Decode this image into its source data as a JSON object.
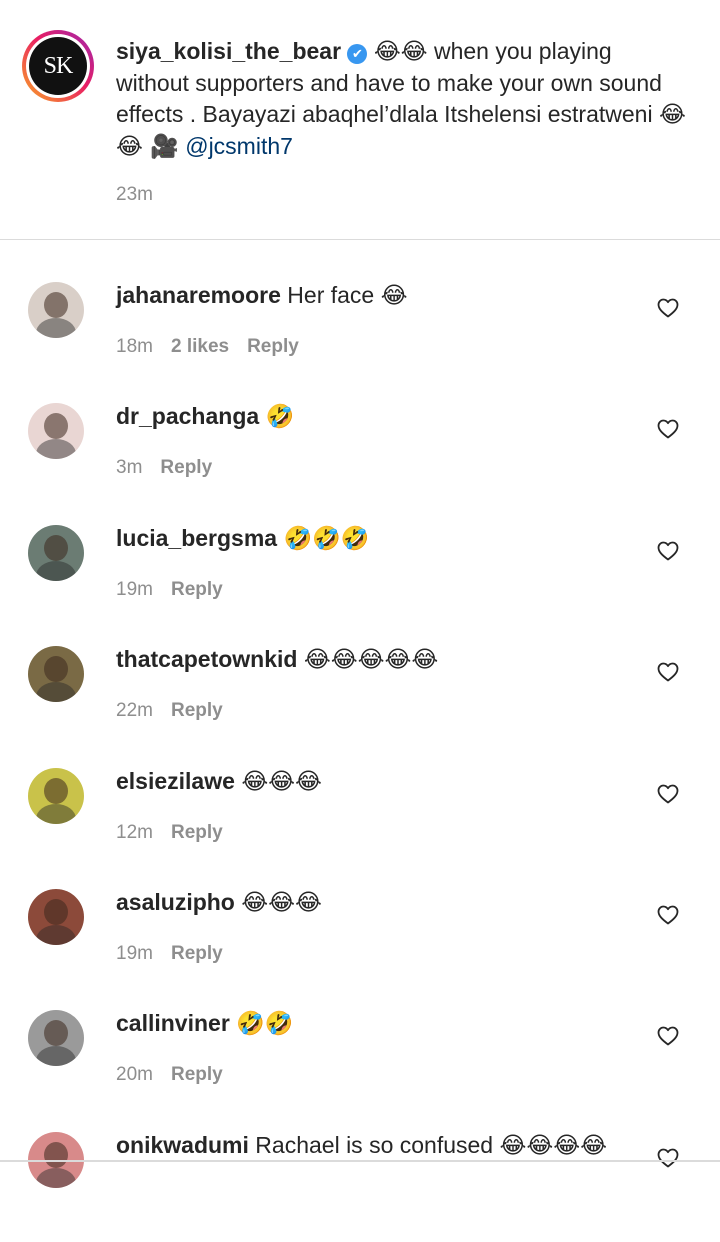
{
  "caption": {
    "avatar_initials": "SK",
    "username": "siya_kolisi_the_bear",
    "verified_mark": "✔",
    "text_emoji_lead": "😂😂",
    "text": "when you playing without supporters and have to make your own sound effects . Bayayazi abaqhel’dlala Itshelensi estratweni",
    "text_emoji_tail": "😂😂 🎥",
    "mention": "@jcsmith7",
    "time": "23m"
  },
  "comments": [
    {
      "username": "jahanaremoore",
      "text": "Her face",
      "emoji": "😂",
      "time": "18m",
      "likes": "2 likes",
      "reply": "Reply",
      "avatar_bg": "#d9cfc8"
    },
    {
      "username": "dr_pachanga",
      "text": "",
      "emoji": "🤣",
      "time": "3m",
      "likes": "",
      "reply": "Reply",
      "avatar_bg": "#e9d6d3"
    },
    {
      "username": "lucia_bergsma",
      "text": "",
      "emoji": "🤣🤣🤣",
      "time": "19m",
      "likes": "",
      "reply": "Reply",
      "avatar_bg": "#6b7c73"
    },
    {
      "username": "thatcapetownkid",
      "text": "",
      "emoji": "😂😂😂😂😂",
      "time": "22m",
      "likes": "",
      "reply": "Reply",
      "avatar_bg": "#7a6a45"
    },
    {
      "username": "elsiezilawe",
      "text": "",
      "emoji": "😂😂😂",
      "time": "12m",
      "likes": "",
      "reply": "Reply",
      "avatar_bg": "#c9c24a"
    },
    {
      "username": "asaluzipho",
      "text": "",
      "emoji": "😂😂😂",
      "time": "19m",
      "likes": "",
      "reply": "Reply",
      "avatar_bg": "#8c4a3a"
    },
    {
      "username": "callinviner",
      "text": "",
      "emoji": "🤣🤣",
      "time": "20m",
      "likes": "",
      "reply": "Reply",
      "avatar_bg": "#9a9a9a"
    },
    {
      "username": "onikwadumi",
      "text": "Rachael is so confused",
      "emoji": "😂😂😂😂",
      "time": "",
      "likes": "",
      "reply": "",
      "avatar_bg": "#d88a8a"
    }
  ],
  "icons": {
    "heart": "heart-outline-icon",
    "verified": "verified-badge-icon"
  },
  "colors": {
    "text": "#262626",
    "muted": "#8e8e8e",
    "link": "#00376b",
    "verified": "#3897f0",
    "divider": "#dbdbdb"
  }
}
